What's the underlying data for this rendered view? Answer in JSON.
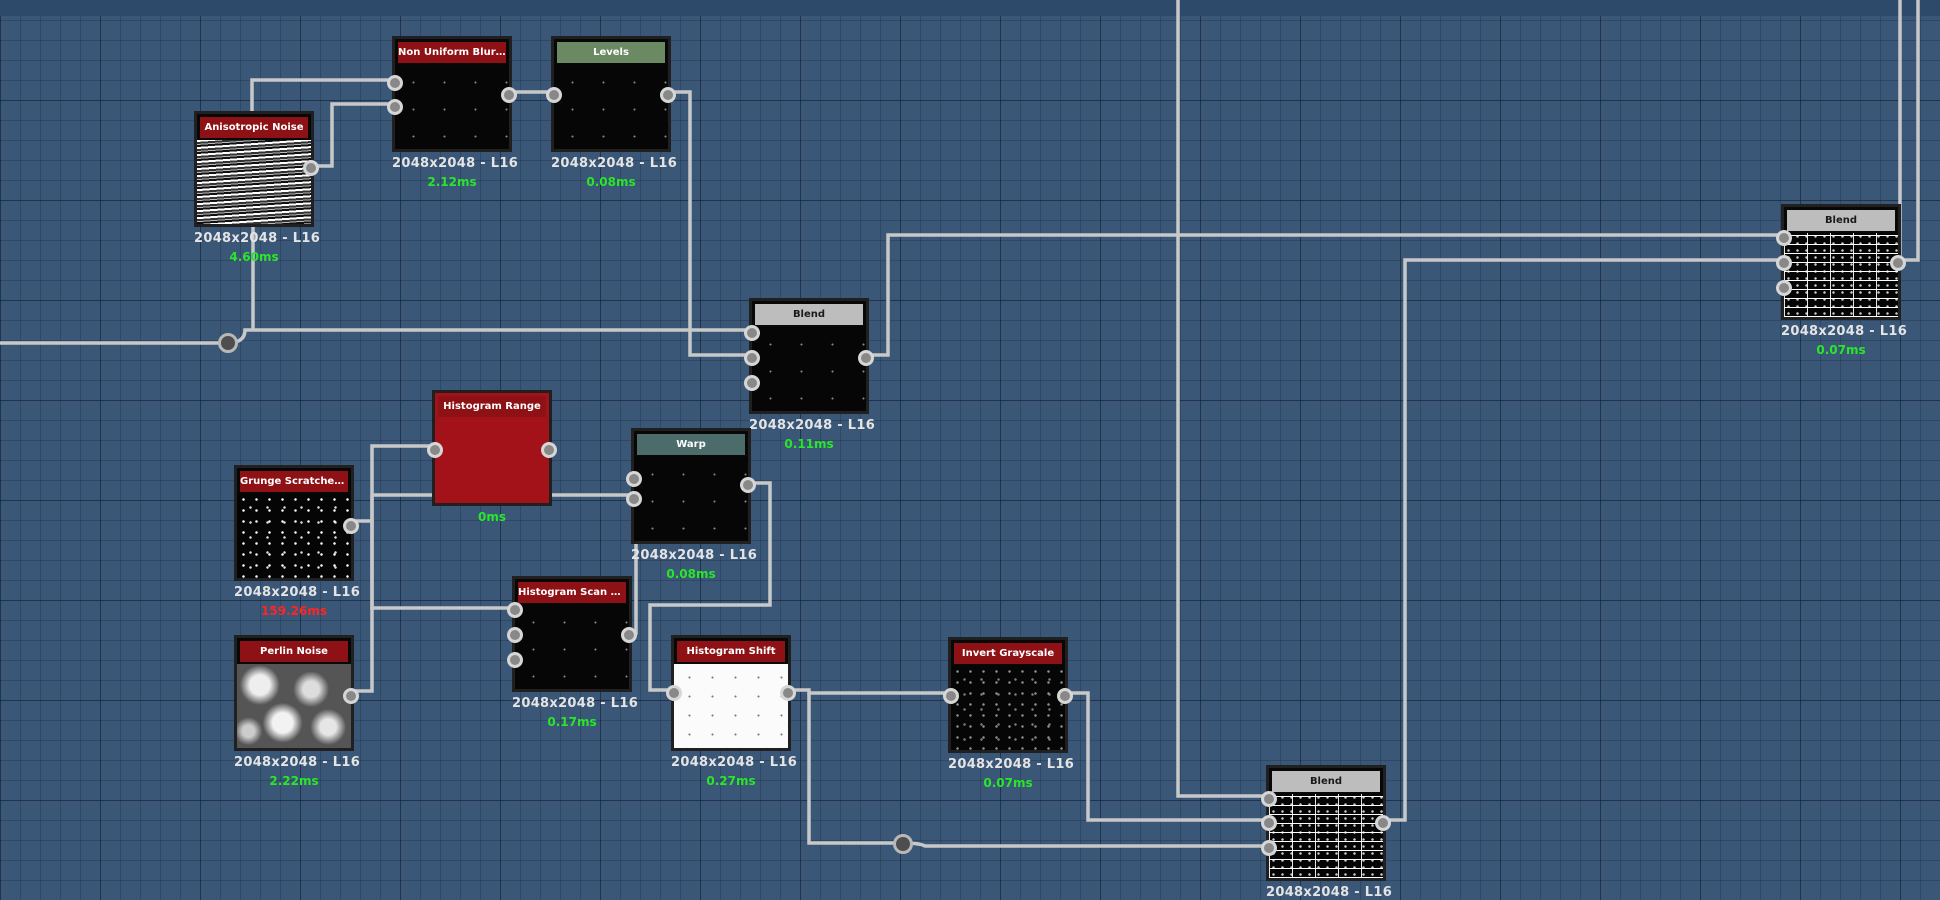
{
  "nodes": {
    "anisotropic_noise": {
      "title": "Anisotropic Noise",
      "res": "2048x2048 - L16",
      "time": "4.60ms"
    },
    "non_uniform_blur": {
      "title": "Non Uniform Blur Gray...",
      "res": "2048x2048 - L16",
      "time": "2.12ms"
    },
    "levels": {
      "title": "Levels",
      "res": "2048x2048 - L16",
      "time": "0.08ms"
    },
    "blend_1": {
      "title": "Blend",
      "res": "2048x2048 - L16",
      "time": "0.11ms"
    },
    "histogram_range": {
      "title": "Histogram Range",
      "time": "0ms"
    },
    "grunge_scratches": {
      "title": "Grunge Scratches Rough",
      "res": "2048x2048 - L16",
      "time": "159.26ms"
    },
    "warp": {
      "title": "Warp",
      "res": "2048x2048 - L16",
      "time": "0.08ms"
    },
    "histogram_scan": {
      "title": "Histogram Scan Non-U...",
      "res": "2048x2048 - L16",
      "time": "0.17ms"
    },
    "perlin_noise": {
      "title": "Perlin Noise",
      "res": "2048x2048 - L16",
      "time": "2.22ms"
    },
    "histogram_shift": {
      "title": "Histogram Shift",
      "res": "2048x2048 - L16",
      "time": "0.27ms"
    },
    "invert_grayscale": {
      "title": "Invert Grayscale",
      "res": "2048x2048 - L16",
      "time": "0.07ms"
    },
    "blend_2": {
      "title": "Blend",
      "res": "2048x2048 - L16",
      "time": "0.07ms"
    },
    "blend_3": {
      "title": "Blend",
      "res": "2048x2048 - L16"
    }
  },
  "colors": {
    "canvas": "#3b5778",
    "wire": "#c8c8c8",
    "time_ok": "#29e629",
    "time_slow": "#ff2525"
  }
}
